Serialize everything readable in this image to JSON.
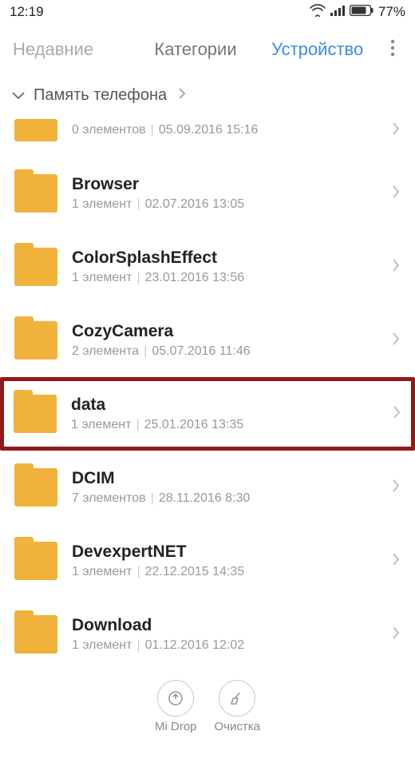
{
  "status": {
    "time": "12:19",
    "battery": "77%"
  },
  "tabs": {
    "recent": "Недавние",
    "categories": "Категории",
    "device": "Устройство"
  },
  "crumb": {
    "label": "Память телефона"
  },
  "rows": {
    "r0": {
      "count": "0 элементов",
      "date": "05.09.2016 15:16"
    },
    "r1": {
      "name": "Browser",
      "count": "1 элемент",
      "date": "02.07.2016 13:05"
    },
    "r2": {
      "name": "ColorSplashEffect",
      "count": "1 элемент",
      "date": "23.01.2016 13:56"
    },
    "r3": {
      "name": "CozyCamera",
      "count": "2 элемента",
      "date": "05.07.2016 11:46"
    },
    "r4": {
      "name": "data",
      "count": "1 элемент",
      "date": "25.01.2016 13:35"
    },
    "r5": {
      "name": "DCIM",
      "count": "7 элементов",
      "date": "28.11.2016 8:30"
    },
    "r6": {
      "name": "DevexpertNET",
      "count": "1 элемент",
      "date": "22.12.2015 14:35"
    },
    "r7": {
      "name": "Download",
      "count": "1 элемент",
      "date": "01.12.2016 12:02"
    }
  },
  "bottom": {
    "midrop": "Mi Drop",
    "clean": "Очистка"
  }
}
